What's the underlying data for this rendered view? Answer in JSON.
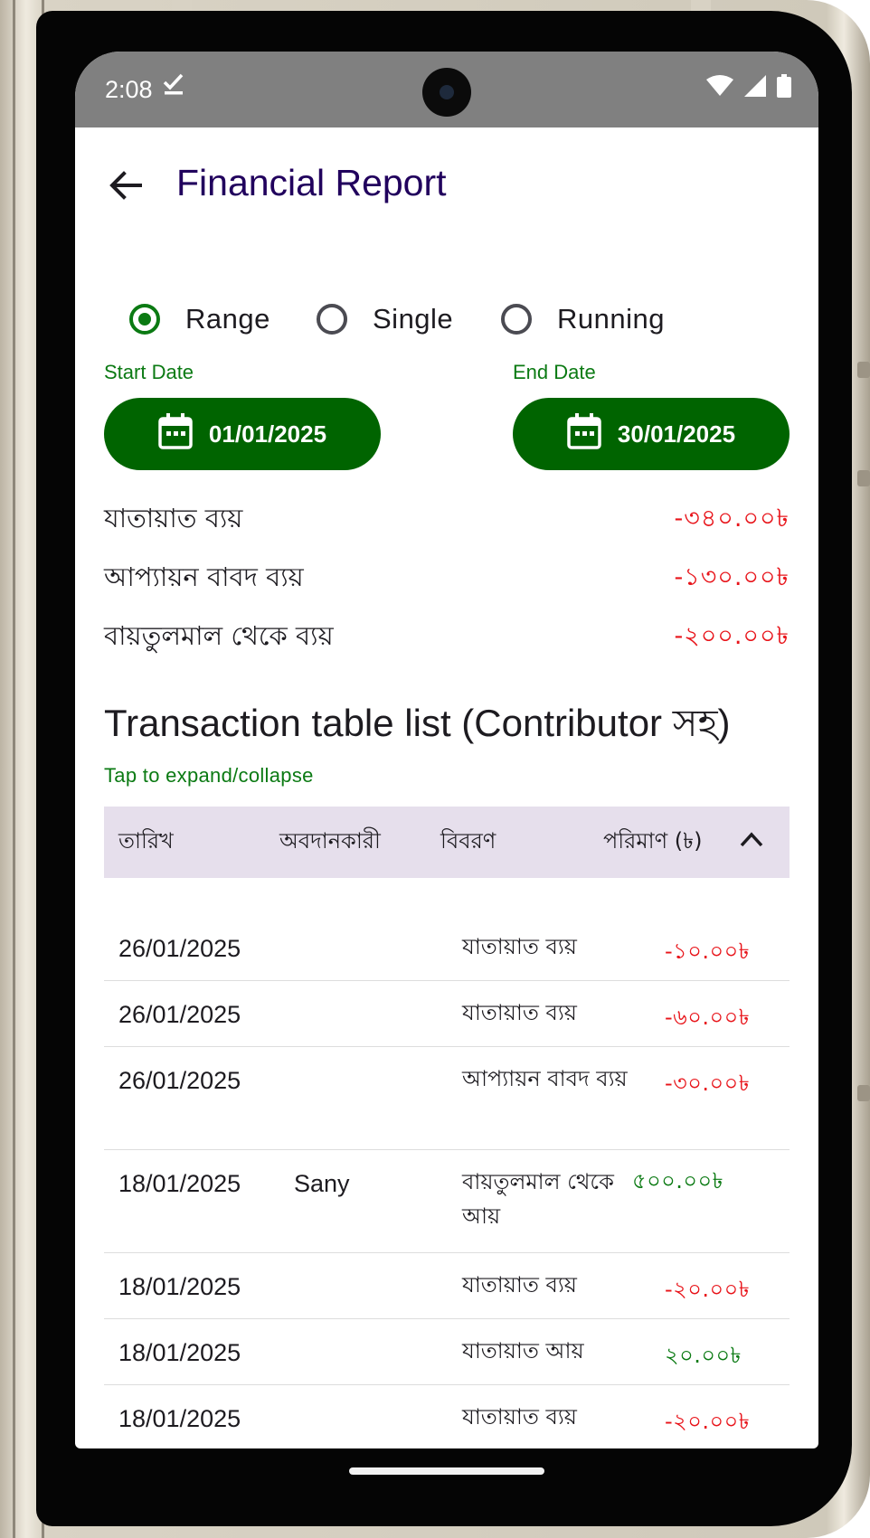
{
  "status_bar": {
    "time": "2:08"
  },
  "header": {
    "title": "Financial Report"
  },
  "mode_options": [
    {
      "label": "Range",
      "selected": true
    },
    {
      "label": "Single",
      "selected": false
    },
    {
      "label": "Running",
      "selected": false
    }
  ],
  "dates": {
    "start_label": "Start Date",
    "start_value": "01/01/2025",
    "end_label": "End Date",
    "end_value": "30/01/2025"
  },
  "summary": [
    {
      "label": "যাতায়াত ব্যয়",
      "value": "-৩৪০.০০৳"
    },
    {
      "label": "আপ্যায়ন বাবদ ব্যয়",
      "value": "-১৩০.০০৳"
    },
    {
      "label": "বায়তুলমাল থেকে ব্যয়",
      "value": "-২০০.০০৳"
    }
  ],
  "table": {
    "title": "Transaction table list (Contributor সহ)",
    "hint": "Tap to expand/collapse",
    "headers": {
      "date": "তারিখ",
      "contributor": "অবদানকারী",
      "description": "বিবরণ",
      "amount": "পরিমাণ (৳)"
    },
    "rows": [
      {
        "date": "26/01/2025",
        "contributor": "",
        "description": "যাতায়াত ব্যয়",
        "amount": "-১০.০০৳",
        "sign": "neg"
      },
      {
        "date": "26/01/2025",
        "contributor": "",
        "description": "যাতায়াত ব্যয়",
        "amount": "-৬০.০০৳",
        "sign": "neg"
      },
      {
        "date": "26/01/2025",
        "contributor": "",
        "description": "আপ্যায়ন বাবদ ব্যয়",
        "amount": "-৩০.০০৳",
        "sign": "neg"
      },
      {
        "date": "18/01/2025",
        "contributor": "Sany",
        "description": "বায়তুলমাল থেকে আয়",
        "amount": "৫০০.০০৳",
        "sign": "pos"
      },
      {
        "date": "18/01/2025",
        "contributor": "",
        "description": "যাতায়াত ব্যয়",
        "amount": "-২০.০০৳",
        "sign": "neg"
      },
      {
        "date": "18/01/2025",
        "contributor": "",
        "description": "যাতায়াত আয়",
        "amount": "২০.০০৳",
        "sign": "pos"
      },
      {
        "date": "18/01/2025",
        "contributor": "",
        "description": "যাতায়াত ব্যয়",
        "amount": "-২০.০০৳",
        "sign": "neg"
      }
    ]
  },
  "colors": {
    "accent_green": "#006400",
    "title_purple": "#21005d",
    "negative_red": "#e8141a",
    "positive_green": "#0b7a13",
    "header_bg": "#e6dfec"
  }
}
